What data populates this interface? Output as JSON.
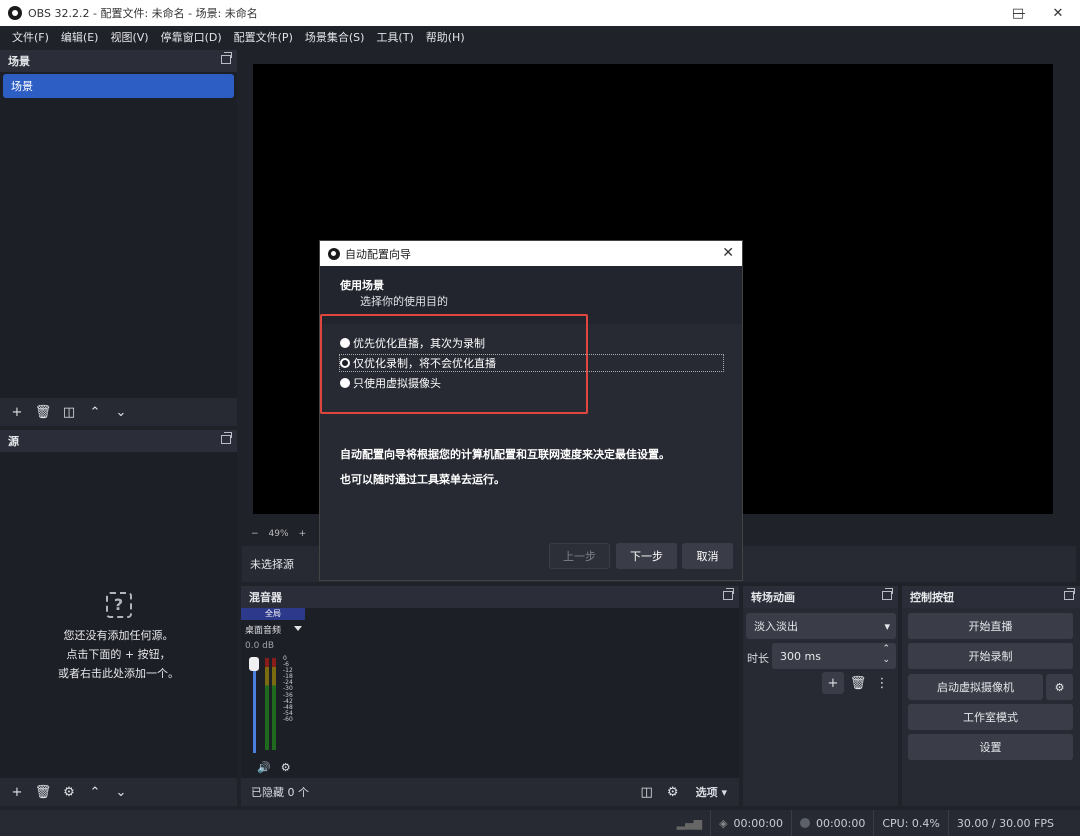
{
  "window": {
    "title": "OBS 32.2.2 - 配置文件: 未命名 - 场景: 未命名"
  },
  "menu": [
    "文件(F)",
    "编辑(E)",
    "视图(V)",
    "停靠窗口(D)",
    "配置文件(P)",
    "场景集合(S)",
    "工具(T)",
    "帮助(H)"
  ],
  "scenes": {
    "title": "场景",
    "items": [
      "场景"
    ]
  },
  "sources": {
    "title": "源",
    "empty_line1": "您还没有添加任何源。",
    "empty_line2": "点击下面的 + 按钮，",
    "empty_line3": "或者右击此处添加一个。"
  },
  "preview": {
    "zoom": "49%"
  },
  "source_bar": {
    "label": "未选择源"
  },
  "mixer": {
    "title": "混音器",
    "channel_tag": "全局",
    "channel_name": "桌面音频",
    "db": "0.0 dB",
    "ticks": [
      "0",
      "-6",
      "-12",
      "-18",
      "-24",
      "-30",
      "-36",
      "-42",
      "-48",
      "-54",
      "-60"
    ],
    "hidden_label": "已隐藏 0 个",
    "options_label": "选项"
  },
  "transitions": {
    "title": "转场动画",
    "type": "淡入淡出",
    "duration_label": "时长",
    "duration": "300 ms"
  },
  "controls": {
    "title": "控制按钮",
    "start_stream": "开始直播",
    "start_record": "开始录制",
    "virtual_cam": "启动虚拟摄像机",
    "studio_mode": "工作室模式",
    "settings": "设置"
  },
  "status": {
    "stream_time": "00:00:00",
    "record_time": "00:00:00",
    "cpu": "CPU: 0.4%",
    "fps": "30.00 / 30.00 FPS"
  },
  "dialog": {
    "title": "自动配置向导",
    "heading": "使用场景",
    "subheading": "选择你的使用目的",
    "options": [
      "优先优化直播，其次为录制",
      "仅优化录制，将不会优化直播",
      "只使用虚拟摄像头"
    ],
    "selected_index": 1,
    "desc1": "自动配置向导将根据您的计算机配置和互联网速度来决定最佳设置。",
    "desc2": "也可以随时通过工具菜单去运行。",
    "back": "上一步",
    "next": "下一步",
    "cancel": "取消"
  },
  "colors": {
    "accent": "#2d5ec4",
    "highlight_box": "#e0463e"
  }
}
